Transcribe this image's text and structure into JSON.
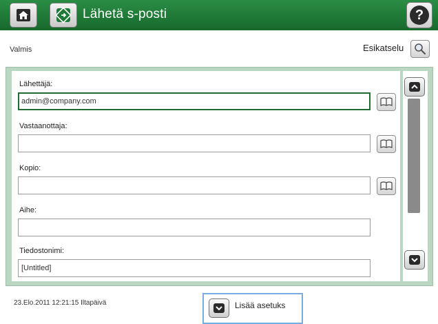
{
  "header": {
    "title": "Lähetä s-posti",
    "home_icon": "home-icon",
    "app_icon": "send-email-icon",
    "help_glyph": "?"
  },
  "status": {
    "text": "Valmis",
    "preview_label": "Esikatselu"
  },
  "form": {
    "from_label": "Lähettäjä:",
    "from_value": "admin@company.com",
    "to_label": "Vastaanottaja:",
    "to_value": "",
    "cc_label": "Kopio:",
    "cc_value": "",
    "subject_label": "Aihe:",
    "subject_value": "",
    "filename_label": "Tiedostonimi:",
    "filename_value": "[Untitled]"
  },
  "footer": {
    "datetime": "23.Elo.2011 12:21:15 Iltapäivä",
    "more_options_label": "Lisää asetuks"
  },
  "colors": {
    "title_bar": "#1d7a35",
    "panel": "#b9d7c1",
    "focus_border": "#206b33",
    "selection_border": "#74aee0"
  }
}
